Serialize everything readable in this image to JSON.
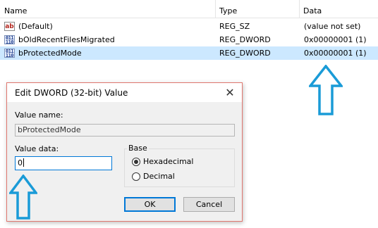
{
  "columns": {
    "name": "Name",
    "type": "Type",
    "data": "Data"
  },
  "rows": [
    {
      "icon": "string-value-icon",
      "icon_text": "ab",
      "name": "(Default)",
      "type": "REG_SZ",
      "data": "(value not set)"
    },
    {
      "icon": "binary-value-icon",
      "icon_text": "011\n110",
      "name": "bOldRecentFilesMigrated",
      "type": "REG_DWORD",
      "data": "0x00000001 (1)"
    },
    {
      "icon": "binary-value-icon",
      "icon_text": "011\n110",
      "name": "bProtectedMode",
      "type": "REG_DWORD",
      "data": "0x00000001 (1)",
      "selected": true
    }
  ],
  "dialog": {
    "title": "Edit DWORD (32-bit) Value",
    "close_glyph": "✕",
    "value_name_label": "Value name:",
    "value_name": "bProtectedMode",
    "value_data_label": "Value data:",
    "value_data": "0",
    "base_label": "Base",
    "base_options": [
      {
        "label": "Hexadecimal",
        "selected": true
      },
      {
        "label": "Decimal",
        "selected": false
      }
    ],
    "ok_label": "OK",
    "cancel_label": "Cancel"
  },
  "colors": {
    "selection": "#cce8ff",
    "arrow": "#1a9bd7",
    "dialog_border": "#e0776f",
    "focus": "#0078d7"
  }
}
